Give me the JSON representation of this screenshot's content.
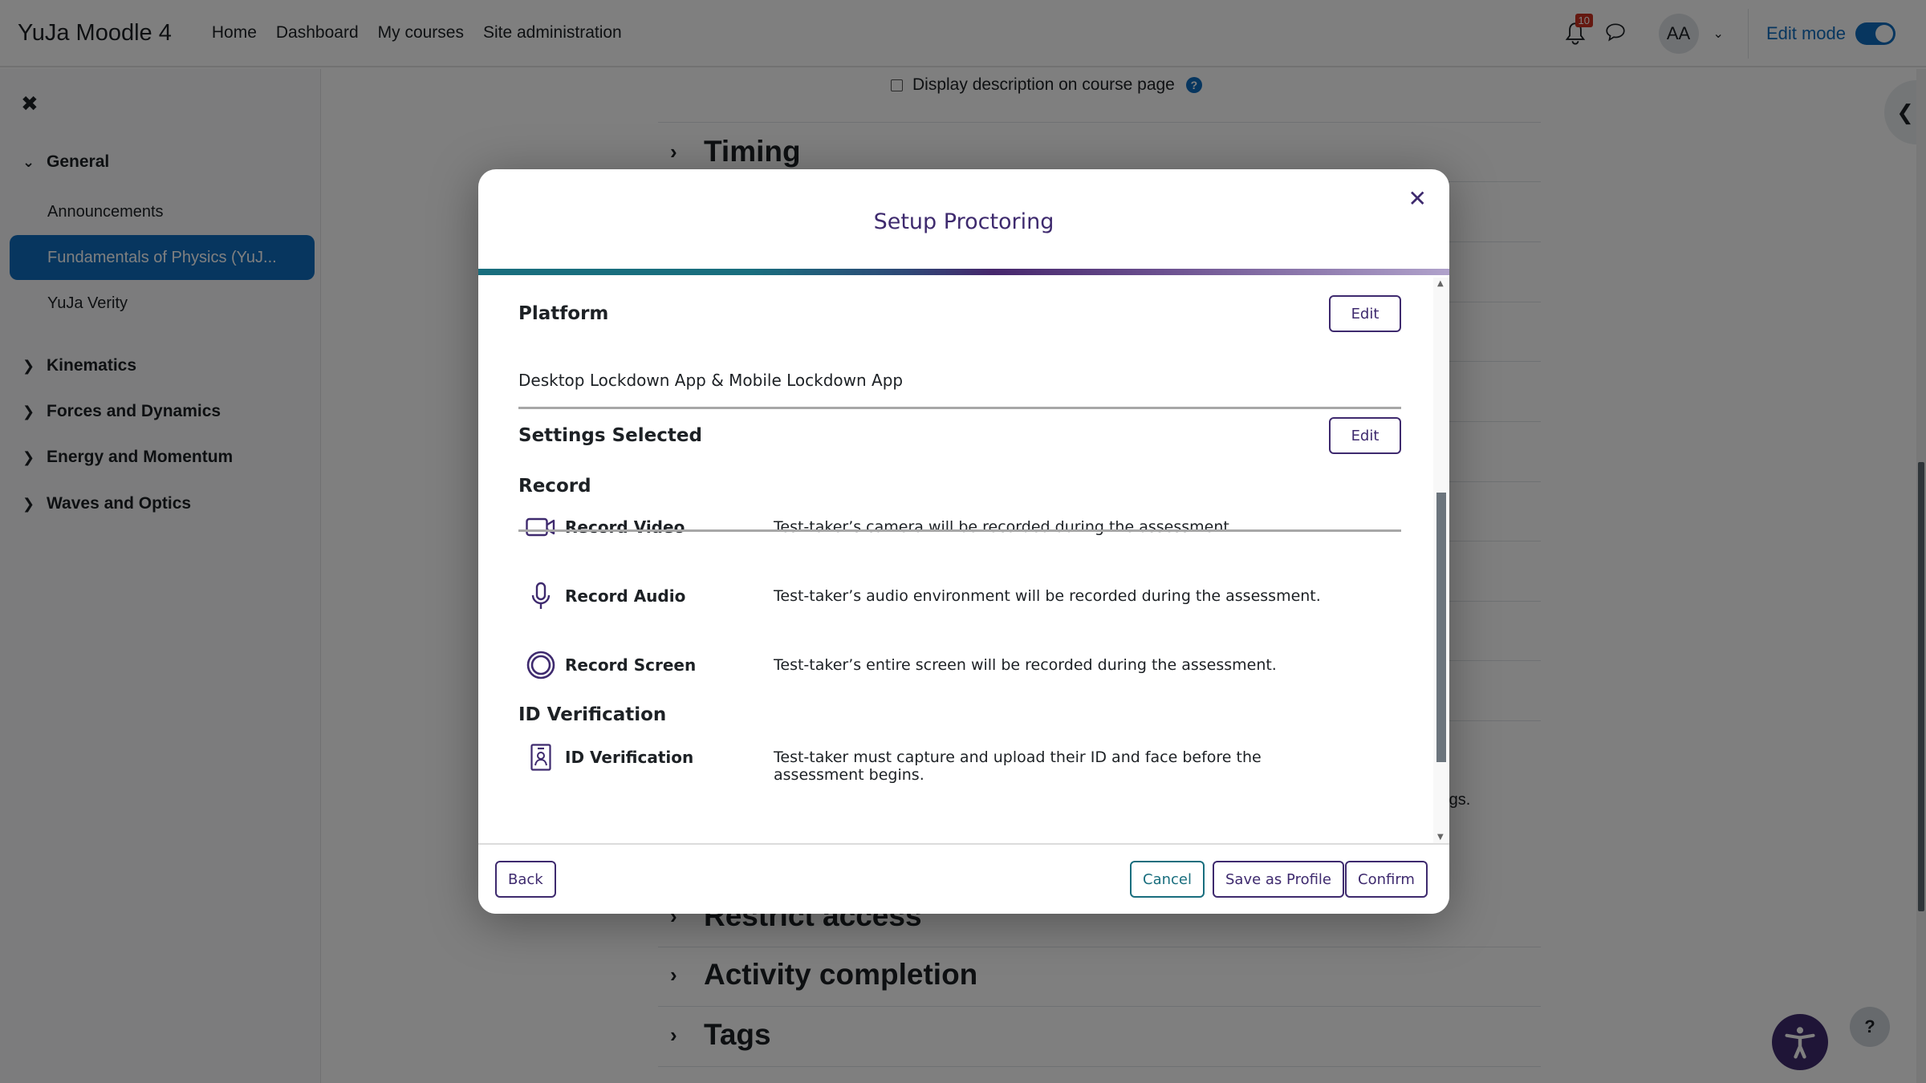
{
  "navbar": {
    "brand": "YuJa Moodle 4",
    "links": [
      "Home",
      "Dashboard",
      "My courses",
      "Site administration"
    ],
    "notification_count": "10",
    "avatar_initials": "AA",
    "edit_mode_label": "Edit mode",
    "edit_mode_on": true
  },
  "drawer": {
    "sections": [
      {
        "label": "General",
        "expanded": true,
        "items": [
          {
            "label": "Announcements",
            "active": false
          },
          {
            "label": "Fundamentals of Physics (YuJ...",
            "active": true
          },
          {
            "label": "YuJa Verity",
            "active": false
          }
        ]
      },
      {
        "label": "Kinematics",
        "expanded": false
      },
      {
        "label": "Forces and Dynamics",
        "expanded": false
      },
      {
        "label": "Energy and Momentum",
        "expanded": false
      },
      {
        "label": "Waves and Optics",
        "expanded": false
      }
    ]
  },
  "main": {
    "display_description_label": "Display description on course page",
    "sections": [
      "Timing",
      "Restrict access",
      "Activity completion",
      "Tags"
    ],
    "partial_text": "ings."
  },
  "modal": {
    "title": "Setup Proctoring",
    "platform": {
      "heading": "Platform",
      "edit_label": "Edit",
      "value": "Desktop Lockdown App & Mobile Lockdown App"
    },
    "settings": {
      "heading": "Settings Selected",
      "edit_label": "Edit",
      "groups": [
        {
          "heading": "Record",
          "items": [
            {
              "icon": "video-camera-icon",
              "name": "Record Video",
              "desc": "Test-taker’s camera will be recorded during the assessment."
            },
            {
              "icon": "microphone-icon",
              "name": "Record Audio",
              "desc": "Test-taker’s audio environment will be recorded during the assessment."
            },
            {
              "icon": "screen-record-icon",
              "name": "Record Screen",
              "desc": "Test-taker’s entire screen will be recorded during the assessment."
            }
          ]
        },
        {
          "heading": "ID Verification",
          "items": [
            {
              "icon": "id-badge-icon",
              "name": "ID Verification",
              "desc": "Test-taker must capture and upload their ID and face before the assessment begins."
            }
          ]
        }
      ]
    },
    "footer": {
      "back": "Back",
      "cancel": "Cancel",
      "save_profile": "Save as Profile",
      "confirm": "Confirm"
    }
  },
  "colors": {
    "accent_purple": "#3e2a6e",
    "accent_teal": "#196e7e",
    "moodle_blue": "#0f6cbf",
    "notification_red": "#ca3120"
  },
  "widgets": {
    "help_label": "?"
  }
}
